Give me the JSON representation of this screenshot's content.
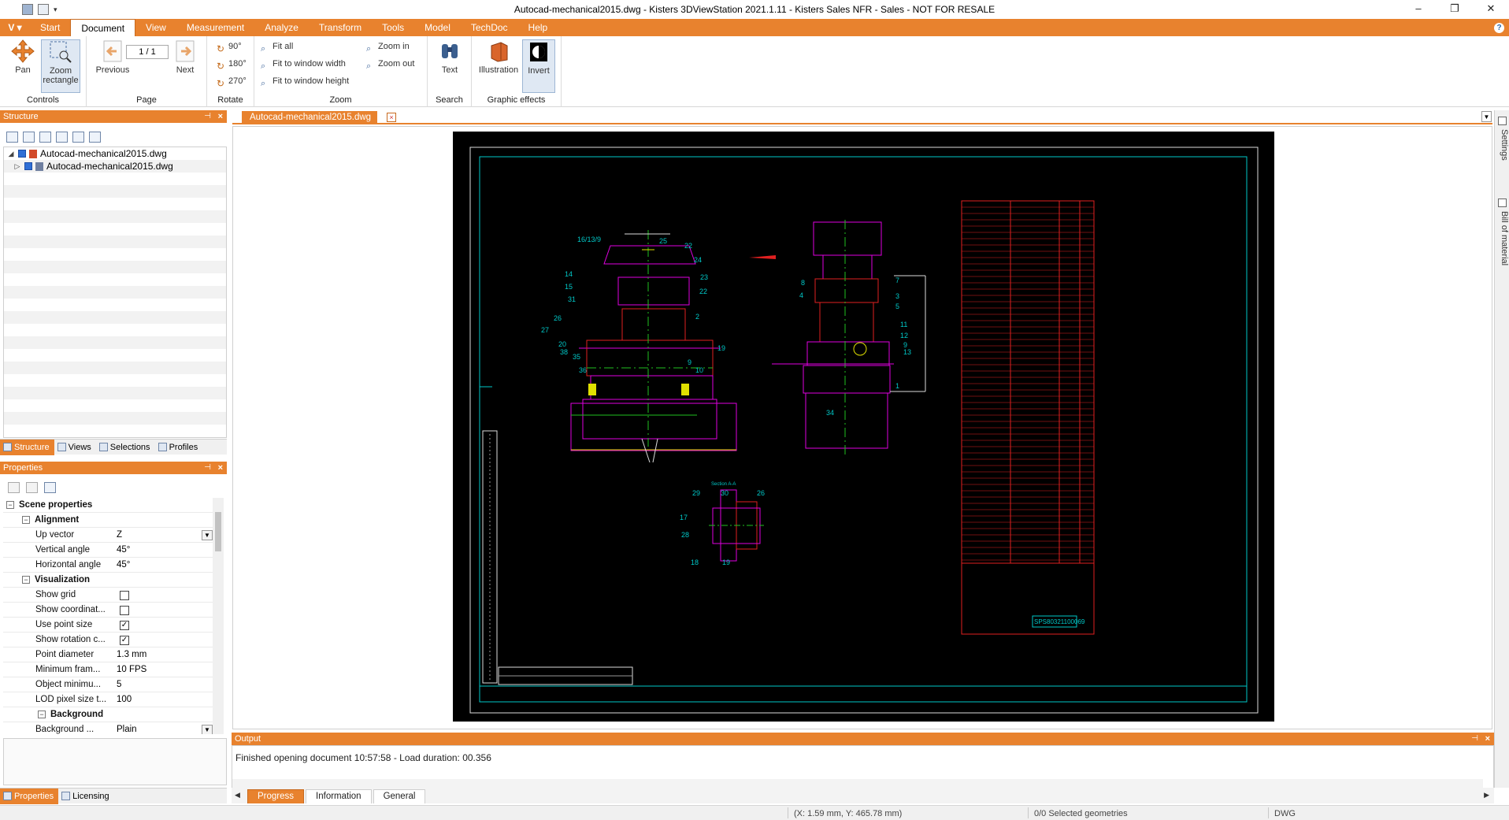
{
  "window": {
    "title": "Autocad-mechanical2015.dwg - Kisters 3DViewStation 2021.1.11 - Kisters Sales NFR - Sales - NOT FOR RESALE",
    "controls": [
      "–",
      "❐",
      "✕"
    ]
  },
  "ribbon": {
    "app_button": "V",
    "tabs": [
      "Start",
      "Document",
      "View",
      "Measurement",
      "Analyze",
      "Transform",
      "Tools",
      "Model",
      "TechDoc",
      "Help"
    ],
    "active_tab": "Document",
    "groups": {
      "controls": {
        "label": "Controls",
        "pan": "Pan",
        "zoom_rect": "Zoom rectangle"
      },
      "page": {
        "label": "Page",
        "previous": "Previous",
        "next": "Next",
        "page_value": "1 / 1"
      },
      "rotate": {
        "label": "Rotate",
        "r90": "90°",
        "r180": "180°",
        "r270": "270°"
      },
      "zoom": {
        "label": "Zoom",
        "fit_all": "Fit all",
        "fit_width": "Fit to window width",
        "fit_height": "Fit to window height",
        "zoom_in": "Zoom in",
        "zoom_out": "Zoom out"
      },
      "search": {
        "label": "Search",
        "text": "Text"
      },
      "graphic_effects": {
        "label": "Graphic effects",
        "illustration": "Illustration",
        "invert": "Invert"
      }
    }
  },
  "structure": {
    "title": "Structure",
    "tree": [
      {
        "label": "Autocad-mechanical2015.dwg"
      },
      {
        "label": "Autocad-mechanical2015.dwg"
      }
    ],
    "tabs": [
      "Structure",
      "Views",
      "Selections",
      "Profiles"
    ]
  },
  "properties": {
    "title": "Properties",
    "scene_properties": "Scene properties",
    "alignment": "Alignment",
    "up_vector": {
      "label": "Up vector",
      "value": "Z"
    },
    "vertical_angle": {
      "label": "Vertical angle",
      "value": "45°"
    },
    "horizontal_angle": {
      "label": "Horizontal angle",
      "value": "45°"
    },
    "visualization": "Visualization",
    "show_grid": {
      "label": "Show grid",
      "checked": false
    },
    "show_coordinates": {
      "label": "Show coordinat...",
      "checked": false
    },
    "use_point_size": {
      "label": "Use point size",
      "checked": true
    },
    "show_rotation": {
      "label": "Show rotation c...",
      "checked": true
    },
    "point_diameter": {
      "label": "Point diameter",
      "value": "1.3 mm"
    },
    "min_framerate": {
      "label": "Minimum fram...",
      "value": "10 FPS"
    },
    "object_minimum": {
      "label": "Object minimu...",
      "value": "5"
    },
    "lod_pixel": {
      "label": "LOD pixel size t...",
      "value": "100"
    },
    "background": "Background",
    "background_type": {
      "label": "Background ...",
      "value": "Plain"
    },
    "tabs": [
      "Properties",
      "Licensing"
    ]
  },
  "document": {
    "tab_label": "Autocad-mechanical2015.dwg"
  },
  "drawing": {
    "balloons_front": [
      "16/13/9",
      "25",
      "22",
      "24",
      "14",
      "23",
      "15",
      "22",
      "31",
      "26",
      "2",
      "27",
      "20",
      "38",
      "19",
      "35",
      "36",
      "9",
      "10"
    ],
    "balloons_side": [
      "8",
      "7",
      "4",
      "3",
      "5",
      "11",
      "12",
      "9",
      "13",
      "1",
      "34"
    ],
    "balloons_section": [
      "29",
      "30",
      "26",
      "17",
      "28",
      "18",
      "19"
    ],
    "section_label": "Section A-A",
    "part_number": "SPS80321100069"
  },
  "side_tabs": [
    "Settings",
    "Bill of material"
  ],
  "output": {
    "title": "Output",
    "message": "Finished opening document 10:57:58 - Load duration: 00.356",
    "tabs": [
      "Progress",
      "Information",
      "General"
    ],
    "active_tab": "Progress"
  },
  "status": {
    "coords": "(X: 1.59 mm, Y: 465.78 mm)",
    "selected": "0/0 Selected geometries",
    "format": "DWG"
  },
  "colors": {
    "accent": "#e8822e",
    "drawing_bg": "#000000",
    "cad_cyan": "#00c8c8",
    "cad_magenta": "#e000e0",
    "cad_red": "#e02020",
    "cad_green": "#20c020",
    "cad_yellow": "#e0e000"
  }
}
